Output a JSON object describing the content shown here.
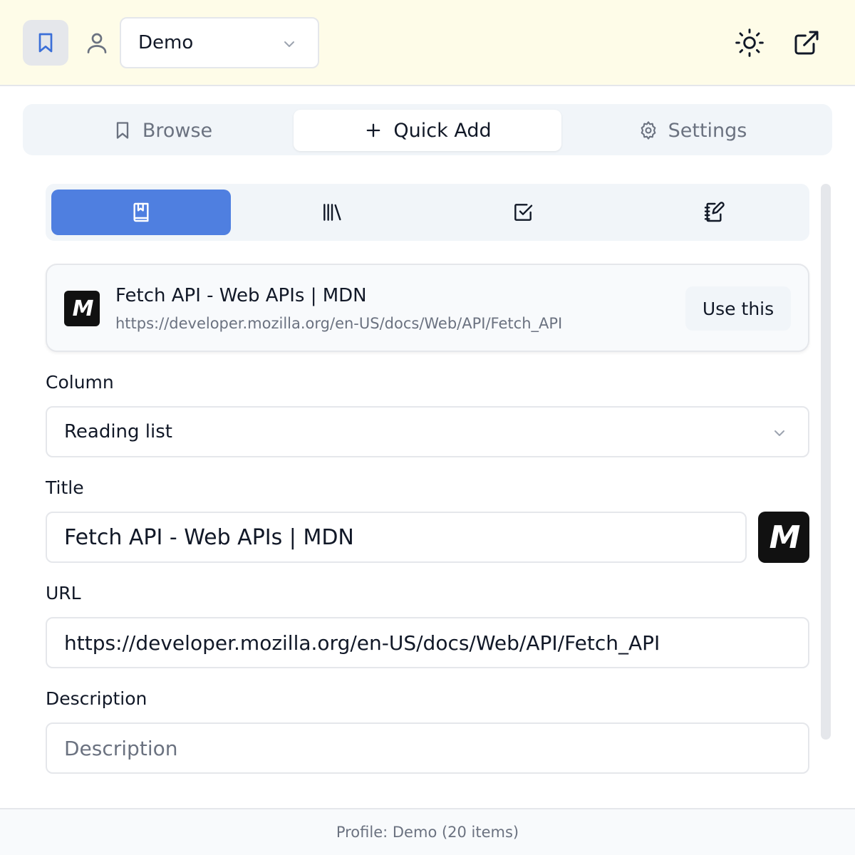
{
  "header": {
    "profile_select": {
      "value": "Demo"
    }
  },
  "main_tabs": [
    {
      "label": "Browse",
      "icon": "bookmark-icon",
      "active": false
    },
    {
      "label": "Quick Add",
      "icon": "plus-icon",
      "active": true
    },
    {
      "label": "Settings",
      "icon": "gear-icon",
      "active": false
    }
  ],
  "mode_tabs": [
    {
      "icon": "book-bookmark-icon",
      "active": true
    },
    {
      "icon": "library-icon",
      "active": false
    },
    {
      "icon": "checkbox-icon",
      "active": false
    },
    {
      "icon": "notebook-pen-icon",
      "active": false
    }
  ],
  "suggestion": {
    "favicon_text": "M",
    "title": "Fetch API - Web APIs | MDN",
    "url": "https://developer.mozilla.org/en-US/docs/Web/API/Fetch_API",
    "use_label": "Use this"
  },
  "form": {
    "column_label": "Column",
    "column_value": "Reading list",
    "title_label": "Title",
    "title_value": "Fetch API - Web APIs | MDN",
    "url_label": "URL",
    "url_value": "https://developer.mozilla.org/en-US/docs/Web/API/Fetch_API",
    "description_label": "Description",
    "description_placeholder": "Description"
  },
  "footer": {
    "status": "Profile: Demo (20 items)"
  },
  "colors": {
    "header_bg": "#fefce8",
    "accent": "#4f7fe0",
    "muted_text": "#6b7280"
  }
}
